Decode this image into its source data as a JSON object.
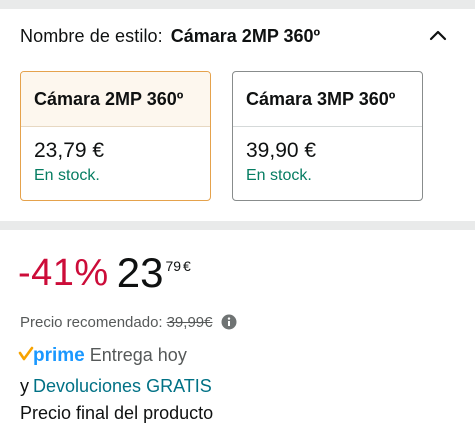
{
  "style_selector": {
    "label": "Nombre de estilo:",
    "selected_value": "Cámara 2MP 360º",
    "options": [
      {
        "title": "Cámara 2MP 360º",
        "price": "23,79 €",
        "stock": "En stock.",
        "selected": true
      },
      {
        "title": "Cámara 3MP 360º",
        "price": "39,90 €",
        "stock": "En stock.",
        "selected": false
      }
    ]
  },
  "price": {
    "discount": "-41%",
    "whole": "23",
    "fraction": "79",
    "currency": "€"
  },
  "recommended": {
    "label": "Precio recomendado:",
    "value": "39,99€"
  },
  "delivery": {
    "prime_word": "prime",
    "text": "Entrega hoy"
  },
  "returns": {
    "prefix": "y",
    "link": "Devoluciones GRATIS"
  },
  "final_price_note": "Precio final del producto",
  "colors": {
    "discount": "#cc0c39",
    "in_stock": "#067d62",
    "link": "#007185",
    "prime_blue": "#1a98ff",
    "selected_border": "#e5a24c"
  }
}
